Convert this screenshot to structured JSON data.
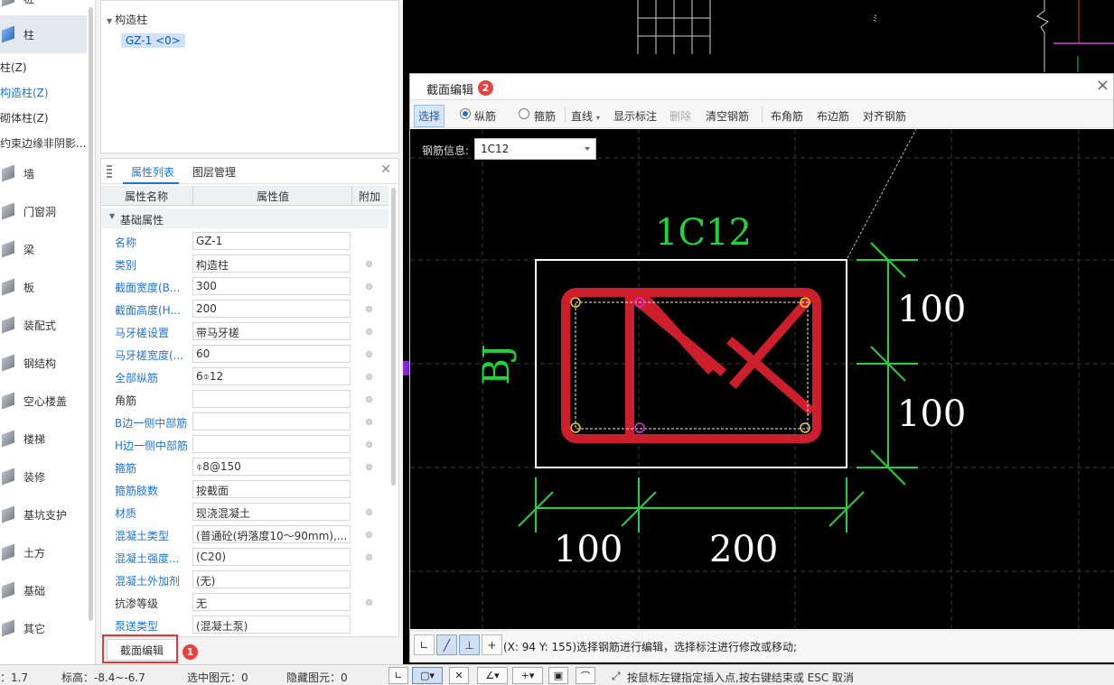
{
  "left_nav": {
    "categories": [
      {
        "label": "桩"
      },
      {
        "label": "柱"
      },
      {
        "label": "墙"
      },
      {
        "label": "门窗洞"
      },
      {
        "label": "梁"
      },
      {
        "label": "板"
      },
      {
        "label": "装配式"
      },
      {
        "label": "钢结构"
      },
      {
        "label": "空心楼盖"
      },
      {
        "label": "楼梯"
      },
      {
        "label": "装修"
      },
      {
        "label": "基坑支护"
      },
      {
        "label": "土方"
      },
      {
        "label": "基础"
      },
      {
        "label": "其它"
      }
    ],
    "subitems": [
      {
        "label": "柱(Z)"
      },
      {
        "label": "构造柱(Z)"
      },
      {
        "label": "砌体柱(Z)"
      },
      {
        "label": "约束边缘非阴影..."
      }
    ],
    "selected_category": "柱",
    "selected_subitem": "构造柱(Z)"
  },
  "tree": {
    "root": "构造柱",
    "leaf": "GZ-1 <0>"
  },
  "properties": {
    "tabs": [
      "属性列表",
      "图层管理"
    ],
    "active_tab": "属性列表",
    "columns": [
      "属性名称",
      "属性值",
      "附加"
    ],
    "group": "基础属性",
    "rows": [
      {
        "name": "名称",
        "value": "GZ-1",
        "dot": false,
        "blue": true
      },
      {
        "name": "类别",
        "value": "构造柱",
        "dot": true,
        "blue": true
      },
      {
        "name": "截面宽度(B...",
        "value": "300",
        "dot": true,
        "blue": true
      },
      {
        "name": "截面高度(H...",
        "value": "200",
        "dot": true,
        "blue": true
      },
      {
        "name": "马牙槎设置",
        "value": "带马牙槎",
        "dot": true,
        "blue": true
      },
      {
        "name": "马牙槎宽度(...",
        "value": "60",
        "dot": true,
        "blue": true
      },
      {
        "name": "全部纵筋",
        "value": "6⌽12",
        "dot": true,
        "blue": true
      },
      {
        "name": "角筋",
        "value": "",
        "dot": true,
        "blue": false
      },
      {
        "name": "B边一侧中部筋",
        "value": "",
        "dot": true,
        "blue": true
      },
      {
        "name": "H边一侧中部筋",
        "value": "",
        "dot": true,
        "blue": true
      },
      {
        "name": "箍筋",
        "value": "⌽8@150",
        "dot": true,
        "blue": true
      },
      {
        "name": "箍筋肢数",
        "value": "按截面",
        "dot": false,
        "blue": true
      },
      {
        "name": "材质",
        "value": "现浇混凝土",
        "dot": true,
        "blue": true
      },
      {
        "name": "混凝土类型",
        "value": "(普通砼(坍落度10～90mm),...",
        "dot": true,
        "blue": true
      },
      {
        "name": "混凝土强度...",
        "value": "(C20)",
        "dot": true,
        "blue": true
      },
      {
        "name": "混凝土外加剂",
        "value": "(无)",
        "dot": false,
        "blue": true
      },
      {
        "name": "抗渗等级",
        "value": "无",
        "dot": true,
        "blue": false
      },
      {
        "name": "泵送类型",
        "value": "(混凝土泵)",
        "dot": false,
        "blue": true
      }
    ]
  },
  "section_edit_button": "截面编辑",
  "badges": {
    "one": "1",
    "two": "2"
  },
  "dialog": {
    "title": "截面编辑",
    "close": "×",
    "toolbar": {
      "select": "选择",
      "longitudinal": "纵筋",
      "stirrup": "箍筋",
      "line": "直线",
      "show_dim": "显示标注",
      "delete": "删除",
      "clear": "清空钢筋",
      "corner": "布角筋",
      "edge": "布边筋",
      "align": "对齐钢筋"
    },
    "rebar_info_label": "钢筋信息:",
    "rebar_info_value": "1C12",
    "drawing": {
      "rebar_label": "1C12",
      "side_label": "BJ",
      "dim_right_top": "100",
      "dim_right_bottom": "100",
      "dim_bottom_left": "100",
      "dim_bottom_right": "200"
    },
    "status_text": "(X: 94 Y: 155)选择钢筋进行编辑，选择标注进行修改或移动;"
  },
  "statusbar": {
    "item0": "：1.7",
    "elevation": "标高：-8.4~-6.7",
    "selected": "选中图元：0",
    "hidden": "隐藏图元：0",
    "hint": "按鼠标左键指定插入点,按右键结束或 ESC 取消"
  },
  "colors": {
    "accent": "#1f73d3",
    "rebar": "#d11f2a",
    "annotation": "#1fd33a"
  }
}
